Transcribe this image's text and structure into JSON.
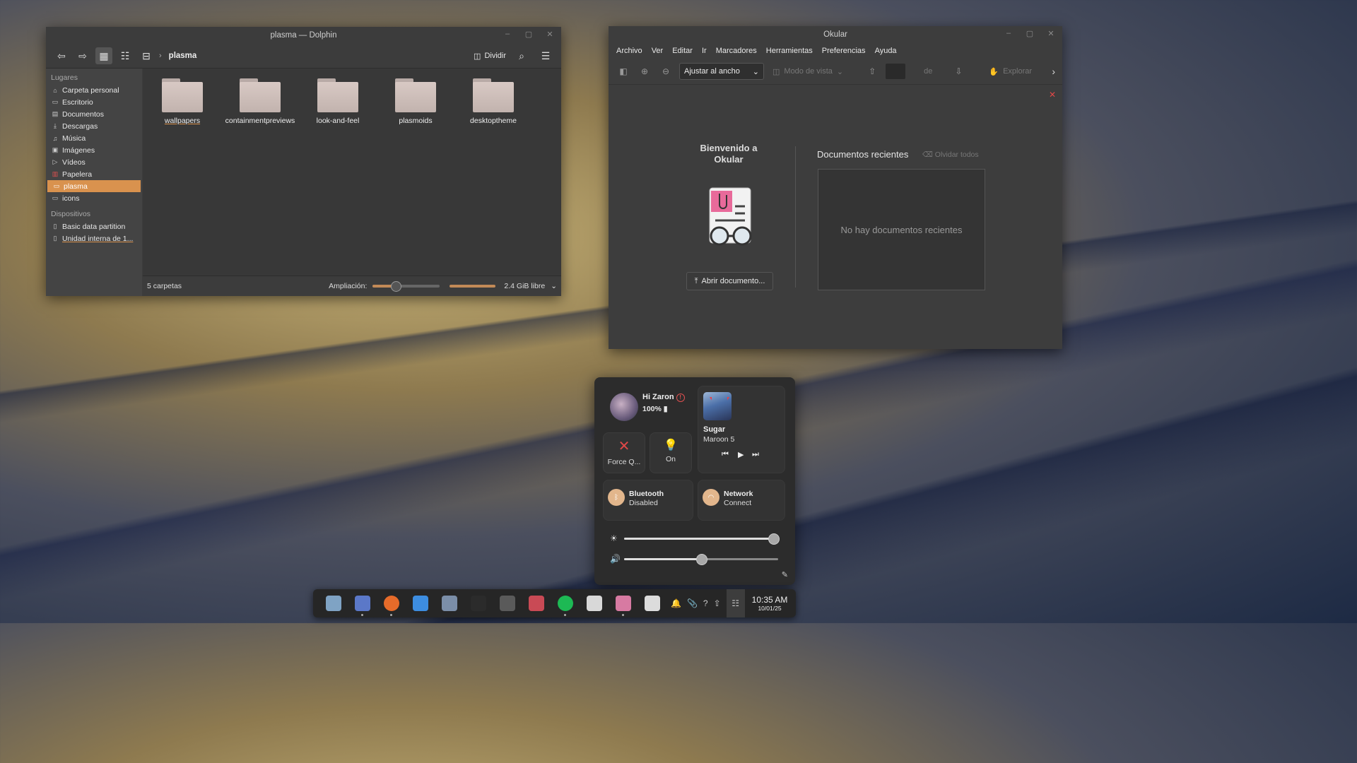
{
  "dolphin": {
    "title": "plasma — Dolphin",
    "breadcrumb": "plasma",
    "split_label": "Dividir",
    "sidebar": {
      "places_header": "Lugares",
      "places": [
        {
          "label": "Carpeta personal",
          "icon": "home-icon"
        },
        {
          "label": "Escritorio",
          "icon": "desktop-icon"
        },
        {
          "label": "Documentos",
          "icon": "documents-icon"
        },
        {
          "label": "Descargas",
          "icon": "download-icon"
        },
        {
          "label": "Música",
          "icon": "music-icon"
        },
        {
          "label": "Imágenes",
          "icon": "image-icon"
        },
        {
          "label": "Vídeos",
          "icon": "video-icon"
        },
        {
          "label": "Papelera",
          "icon": "trash-icon"
        },
        {
          "label": "plasma",
          "icon": "folder-icon"
        },
        {
          "label": "icons",
          "icon": "folder-icon"
        }
      ],
      "devices_header": "Dispositivos",
      "devices": [
        {
          "label": "Basic data partition",
          "icon": "drive-icon"
        },
        {
          "label": "Unidad interna de 1...",
          "icon": "drive-icon"
        }
      ]
    },
    "folders": [
      "wallpapers",
      "containmentpreviews",
      "look-and-feel",
      "plasmoids",
      "desktoptheme"
    ],
    "status": {
      "count": "5 carpetas",
      "zoom_label": "Ampliación:",
      "zoom_level": 0.35,
      "free_space": "2.4 GiB libre"
    }
  },
  "okular": {
    "title": "Okular",
    "menu": [
      "Archivo",
      "Ver",
      "Editar",
      "Ir",
      "Marcadores",
      "Herramientas",
      "Preferencias",
      "Ayuda"
    ],
    "zoom_combo": "Ajustar al ancho",
    "view_mode": "Modo de vista",
    "page_of": "de",
    "browse": "Explorar",
    "welcome": "Bienvenido a Okular",
    "open_button": "Abrir documento...",
    "recent_title": "Documentos recientes",
    "forget_all": "Olvidar todos",
    "no_recent": "No hay documentos recientes"
  },
  "control_center": {
    "greeting": "Hi Zaron",
    "battery": "100%",
    "force_quit": "Force Q...",
    "light_label": "On",
    "media": {
      "song": "Sugar",
      "artist": "Maroon 5"
    },
    "bluetooth": {
      "title": "Bluetooth",
      "status": "Disabled"
    },
    "network": {
      "title": "Network",
      "status": "Connect"
    },
    "brightness": 0.97,
    "volume": 0.5
  },
  "taskbar": {
    "apps": [
      {
        "name": "app-launcher",
        "color": "#7fa3c4"
      },
      {
        "name": "desktop-switcher",
        "color": "#5b78c8"
      },
      {
        "name": "firefox",
        "color": "#e66b2a"
      },
      {
        "name": "discover",
        "color": "#3d8de0"
      },
      {
        "name": "screenshot",
        "color": "#7b8ea8"
      },
      {
        "name": "terminal",
        "color": "#2b2b2b"
      },
      {
        "name": "system-monitor",
        "color": "#5a5a5a"
      },
      {
        "name": "document-viewer",
        "color": "#c94a55"
      },
      {
        "name": "spotify",
        "color": "#1db954"
      },
      {
        "name": "kate",
        "color": "#d8d8d8"
      },
      {
        "name": "okular",
        "color": "#d77aa2"
      },
      {
        "name": "text-editor",
        "color": "#dcdcdc"
      }
    ],
    "time": "10:35 AM",
    "date": "10/01/25"
  },
  "colors": {
    "accent": "#d9924e",
    "panel": "#2c2c2c",
    "alert": "#e04848"
  }
}
